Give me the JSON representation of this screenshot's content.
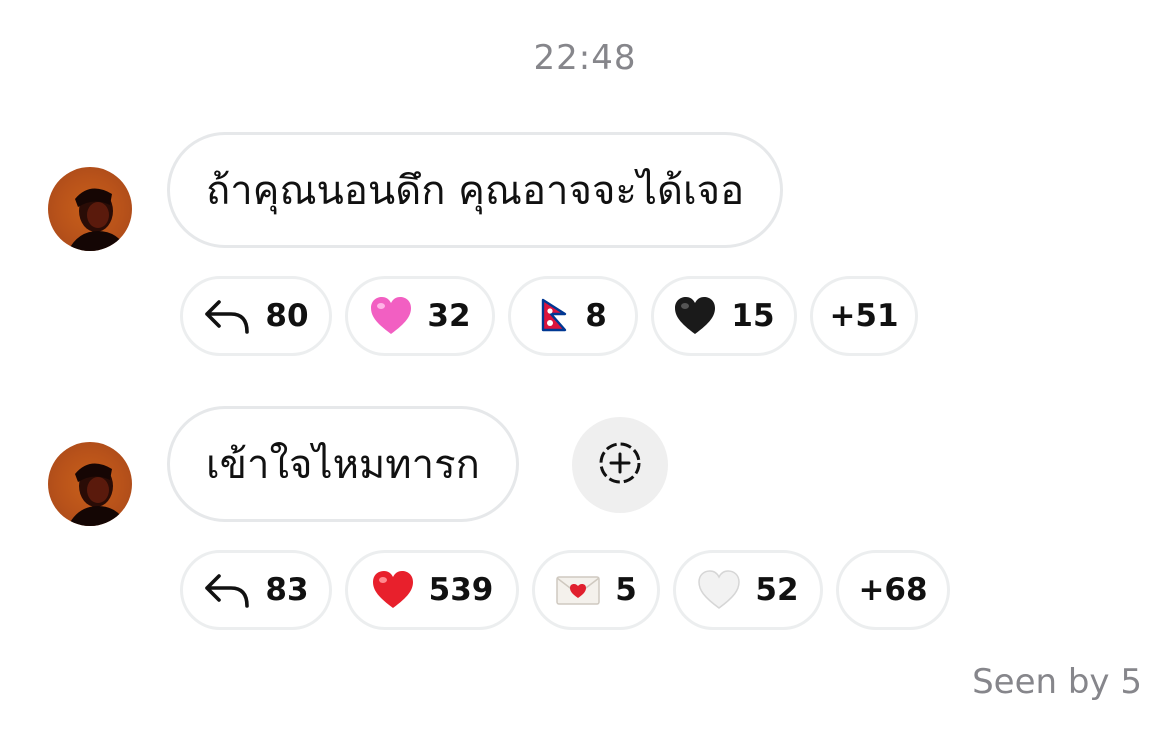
{
  "timestamp": "22:48",
  "messages": [
    {
      "text": "ถ้าคุณนอนดึก คุณอาจจะได้เจอ",
      "reactions": [
        {
          "icon": "reply-arrow-icon",
          "count": "80"
        },
        {
          "icon": "pink-heart-icon",
          "count": "32",
          "color": "#f25fc2"
        },
        {
          "icon": "nepal-flag-icon",
          "count": "8",
          "color": "#dc143c"
        },
        {
          "icon": "black-heart-icon",
          "count": "15",
          "color": "#1a1a1a"
        },
        {
          "icon": "",
          "count": "+51"
        }
      ]
    },
    {
      "text": "เข้าใจไหมทารก",
      "reactions": [
        {
          "icon": "reply-arrow-icon",
          "count": "83"
        },
        {
          "icon": "red-heart-icon",
          "count": "539",
          "color": "#e8202c"
        },
        {
          "icon": "love-letter-icon",
          "count": "5",
          "color": "#e0202e"
        },
        {
          "icon": "white-heart-icon",
          "count": "52",
          "color": "#f2f2f2"
        },
        {
          "icon": "",
          "count": "+68"
        }
      ]
    }
  ],
  "seen_label": "Seen by 5"
}
